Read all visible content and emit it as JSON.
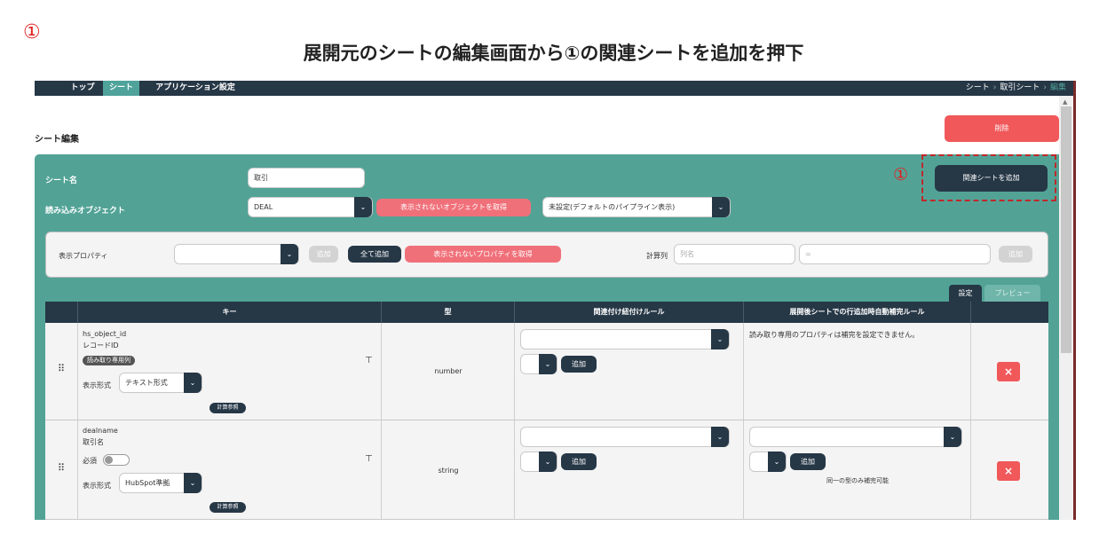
{
  "annotation": {
    "step_marker": "①",
    "instruction": "展開元のシートの編集画面から①の関連シートを追加を押下",
    "marker_near_button": "①",
    "highlight_color": "#c0282a"
  },
  "nav": {
    "items": [
      "トップ",
      "シート",
      "アプリケーション設定"
    ],
    "active": "シート",
    "breadcrumb": [
      "シート",
      "取引シート",
      "編集"
    ]
  },
  "page": {
    "title": "シート編集",
    "delete_label": "削除"
  },
  "form": {
    "sheet_name_label": "シート名",
    "sheet_name_value": "取引",
    "object_label": "読み込みオブジェクト",
    "object_value": "DEAL",
    "hidden_objects_label": "表示されないオブジェクトを取得",
    "pipeline_value": "未設定(デフォルトのパイプライン表示)",
    "add_related_label": "関連シートを追加"
  },
  "properties": {
    "label": "表示プロパティ",
    "select_value": "",
    "add_label": "追加",
    "add_all_label": "全て追加",
    "hidden_props_label": "表示されないプロパティを取得",
    "calc_label": "計算列",
    "col_name_placeholder": "列名",
    "formula_placeholder": "=",
    "calc_add_label": "追加"
  },
  "tabs": {
    "settings": "設定",
    "preview": "プレビュー"
  },
  "table": {
    "headers": [
      "",
      "キー",
      "型",
      "関連付け紐付けルール",
      "展開後シートでの行追加時自動補完ルール",
      ""
    ],
    "rows": [
      {
        "key": "hs_object_id",
        "label": "レコードID",
        "readonly_badge": "読み取り専用列",
        "format_label": "表示形式",
        "format_value": "テキスト形式",
        "calc_ref": "計算参照",
        "type": "number",
        "assoc_add": "追加",
        "autofill_note": "読み取り専用のプロパティは補完を設定できません。"
      },
      {
        "key": "dealname",
        "label": "取引名",
        "required_label": "必須",
        "format_label": "表示形式",
        "format_value": "HubSpot準拠",
        "calc_ref": "計算参照",
        "type": "string",
        "assoc_add": "追加",
        "autofill_add": "追加",
        "autofill_note": "同一の型のみ補完可能"
      }
    ],
    "delete_icon": "×"
  },
  "colors": {
    "navbar": "#263746",
    "teal": "#52a396",
    "red": "#f0585a"
  }
}
